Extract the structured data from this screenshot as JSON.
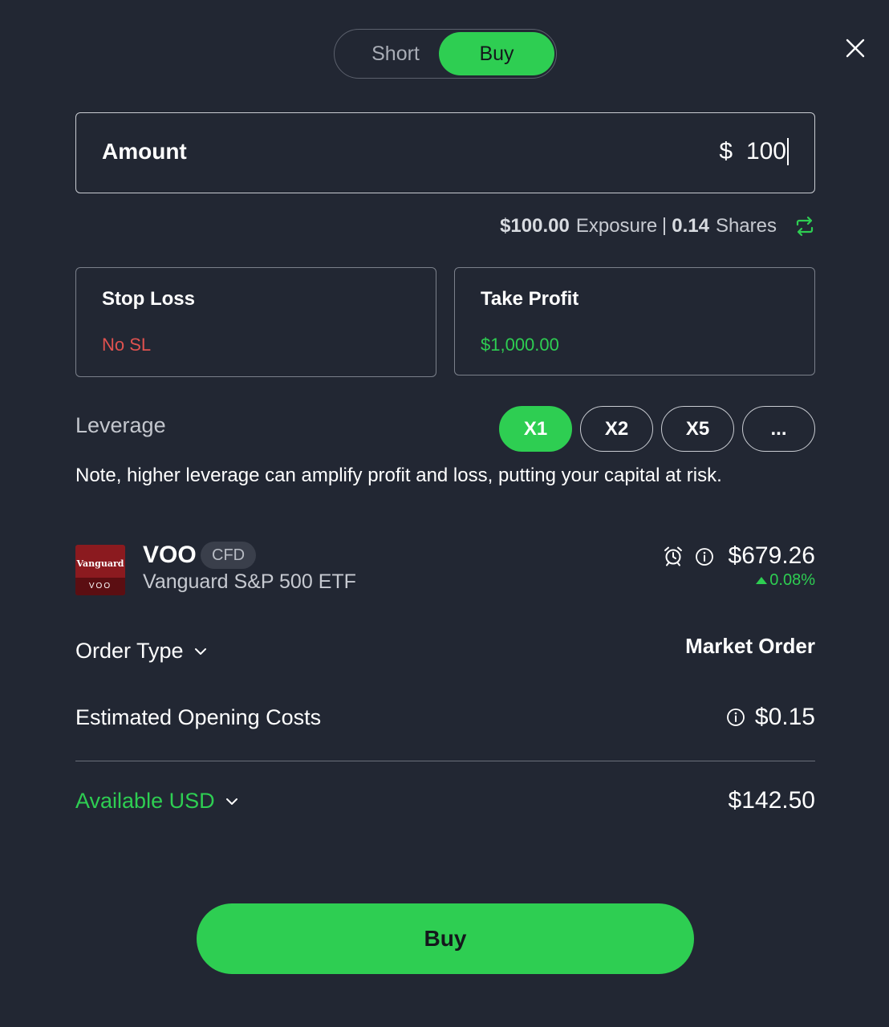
{
  "toggle": {
    "short_label": "Short",
    "buy_label": "Buy",
    "selected": "Buy"
  },
  "amount": {
    "label": "Amount",
    "currency": "$",
    "value": "100"
  },
  "exposure": {
    "amount": "$100.00",
    "exposure_label": "Exposure",
    "shares": "0.14",
    "shares_label": "Shares"
  },
  "stop_loss": {
    "title": "Stop Loss",
    "value": "No SL"
  },
  "take_profit": {
    "title": "Take Profit",
    "value": "$1,000.00"
  },
  "leverage": {
    "label": "Leverage",
    "options": [
      "X1",
      "X2",
      "X5",
      "..."
    ],
    "selected": "X1",
    "note": "Note, higher leverage can amplify profit and loss, putting your capital at risk."
  },
  "instrument": {
    "logo_brand": "Vanguard",
    "logo_ticker": "VOO",
    "ticker": "VOO",
    "badge": "CFD",
    "name": "Vanguard S&P 500 ETF",
    "price": "$679.26",
    "change": "0.08%"
  },
  "order_type": {
    "label": "Order Type",
    "value": "Market Order"
  },
  "costs": {
    "label": "Estimated Opening Costs",
    "value": "$0.15"
  },
  "available": {
    "label": "Available USD",
    "value": "$142.50"
  },
  "submit": {
    "label": "Buy"
  },
  "colors": {
    "background": "#222733",
    "accent": "#2ece52",
    "negative": "#e0524f"
  }
}
